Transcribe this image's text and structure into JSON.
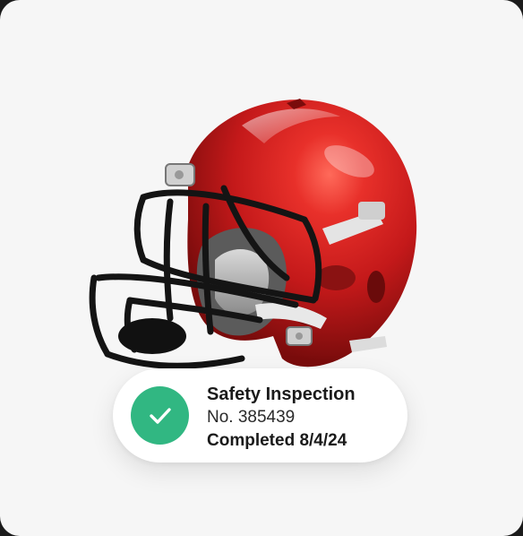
{
  "badge": {
    "title": "Safety Inspection",
    "number": "No. 385439",
    "completed": "Completed 8/4/24",
    "status_color": "#31b782"
  },
  "image": {
    "subject": "football-helmet",
    "primary_color": "#d8231f"
  },
  "icons": {
    "status": "check-icon"
  }
}
